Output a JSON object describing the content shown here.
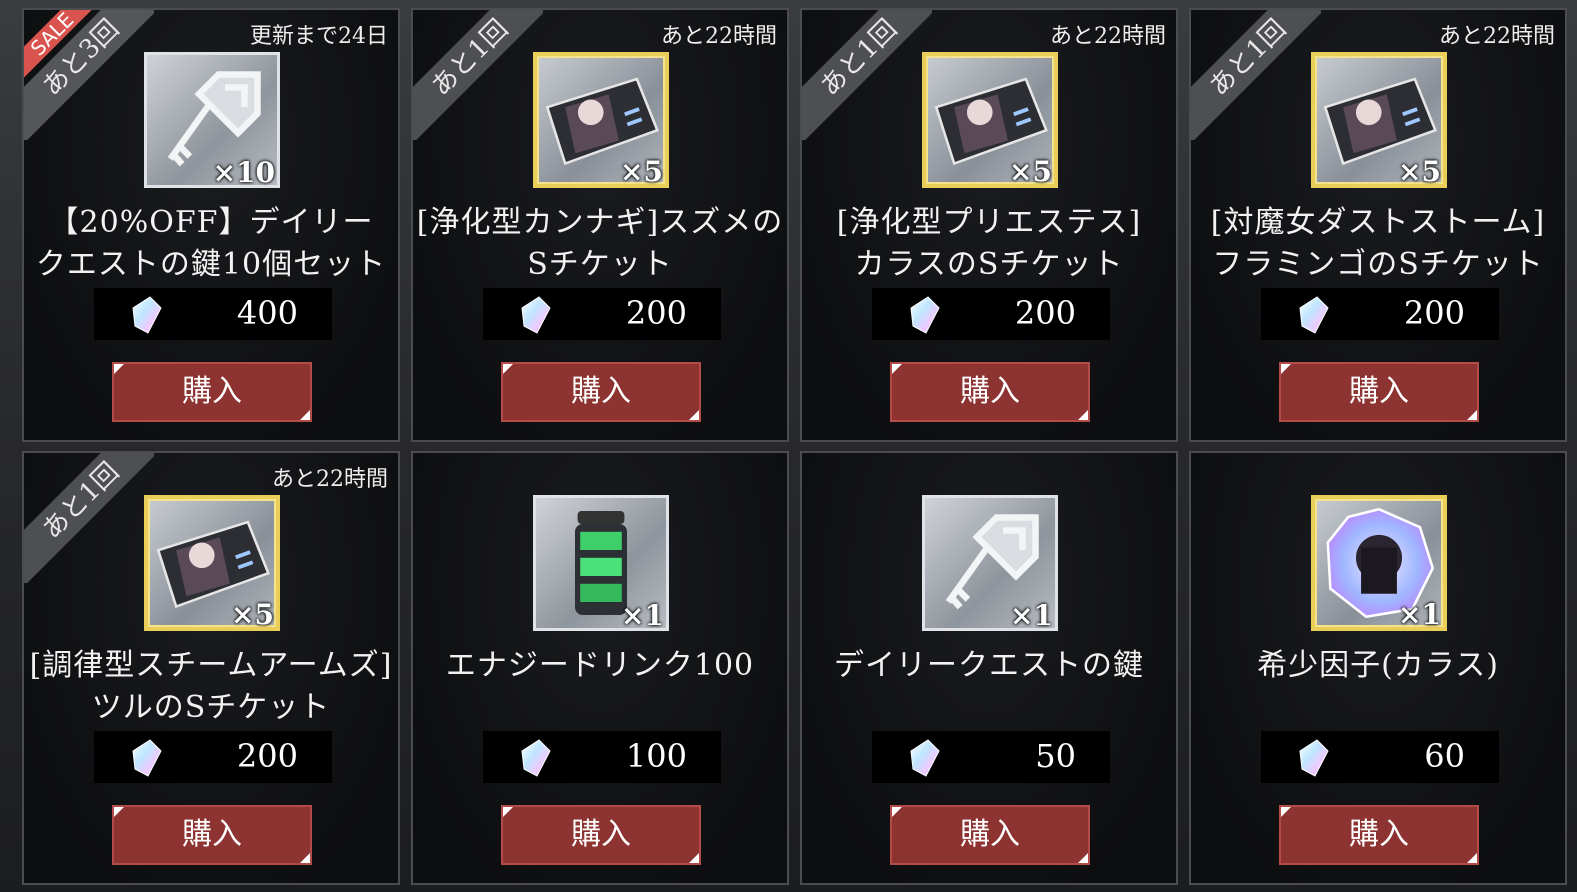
{
  "currency_icon": "crystal-gem-icon",
  "buy_label": "購入",
  "items": [
    {
      "ribbon": "あと3回",
      "sale": "SALE",
      "timer": "更新まで24日",
      "icon": "key-icon",
      "frame": "silver",
      "qty": "×10",
      "name_line1": "【20%OFF】デイリー",
      "name_line2": "クエストの鍵10個セット",
      "price": "400"
    },
    {
      "ribbon": "あと1回",
      "sale": "",
      "timer": "あと22時間",
      "icon": "character-ticket-icon",
      "frame": "gold",
      "qty": "×5",
      "name_line1": "[浄化型カンナギ]スズメの",
      "name_line2": "Sチケット",
      "price": "200"
    },
    {
      "ribbon": "あと1回",
      "sale": "",
      "timer": "あと22時間",
      "icon": "character-ticket-icon",
      "frame": "gold",
      "qty": "×5",
      "name_line1": "[浄化型プリエステス]",
      "name_line2": "カラスのSチケット",
      "price": "200"
    },
    {
      "ribbon": "あと1回",
      "sale": "",
      "timer": "あと22時間",
      "icon": "character-ticket-icon",
      "frame": "gold",
      "qty": "×5",
      "name_line1": "[対魔女ダストストーム]",
      "name_line2": "フラミンゴのSチケット",
      "price": "200"
    },
    {
      "ribbon": "あと1回",
      "sale": "",
      "timer": "あと22時間",
      "icon": "character-ticket-icon",
      "frame": "gold",
      "qty": "×5",
      "name_line1": "[調律型スチームアームズ]",
      "name_line2": "ツルのSチケット",
      "price": "200"
    },
    {
      "ribbon": "",
      "sale": "",
      "timer": "",
      "icon": "energy-drink-icon",
      "frame": "silver",
      "qty": "×1",
      "name_line1": "エナジードリンク100",
      "name_line2": "",
      "price": "100"
    },
    {
      "ribbon": "",
      "sale": "",
      "timer": "",
      "icon": "key-icon",
      "frame": "silver",
      "qty": "×1",
      "name_line1": "デイリークエストの鍵",
      "name_line2": "",
      "price": "50"
    },
    {
      "ribbon": "",
      "sale": "",
      "timer": "",
      "icon": "rare-factor-crystal-icon",
      "frame": "gold",
      "qty": "×1",
      "name_line1": "希少因子(カラス)",
      "name_line2": "",
      "price": "60"
    }
  ]
}
